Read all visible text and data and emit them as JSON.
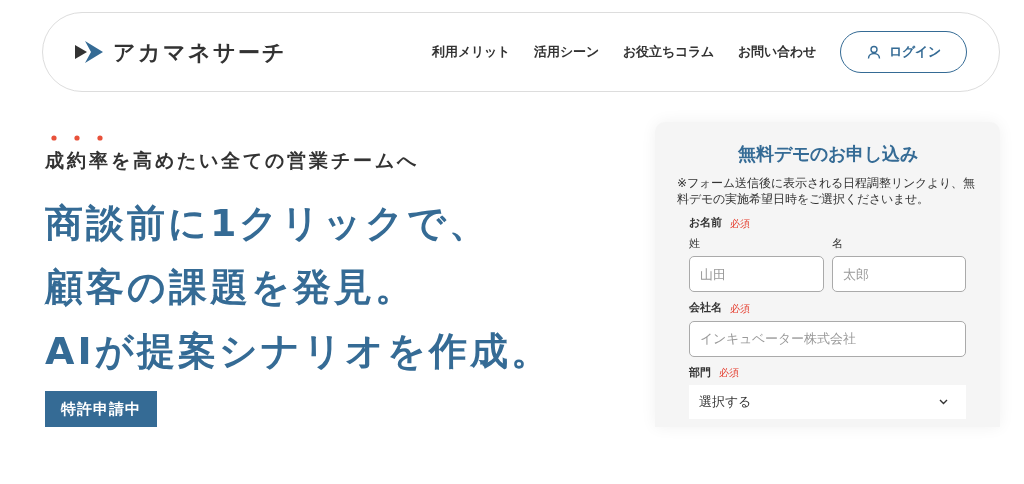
{
  "header": {
    "logo": "アカマネサーチ",
    "nav": [
      "利用メリット",
      "活用シーン",
      "お役立ちコラム",
      "お問い合わせ"
    ],
    "login": "ログイン"
  },
  "hero": {
    "tagline": "成約率を高めたい全ての営業チームへ",
    "headline": [
      "商談前に1クリックで、",
      "顧客の課題を発見。",
      "AIが提案シナリオを作成。"
    ],
    "badge": "特許申請中"
  },
  "form": {
    "title": "無料デモのお申し込み",
    "note": "※フォーム送信後に表示される日程調整リンクより、無料デモの実施希望日時をご選択くださいませ。",
    "fields": [
      {
        "kind": "name",
        "label": "お名前",
        "required": "必須",
        "parts": [
          {
            "label": "姓",
            "placeholder": "山田"
          },
          {
            "label": "名",
            "placeholder": "太郎"
          }
        ]
      },
      {
        "kind": "text",
        "label": "会社名",
        "required": "必須",
        "placeholder": "インキュベーター株式会社"
      },
      {
        "kind": "select",
        "label": "部門",
        "required": "必須",
        "value": "選択する"
      }
    ]
  }
}
